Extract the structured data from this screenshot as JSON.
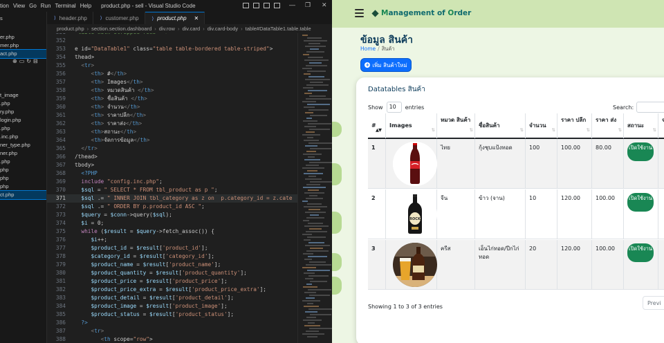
{
  "vscode": {
    "menu": [
      "ction",
      "View",
      "Go",
      "Run",
      "Terminal",
      "Help"
    ],
    "window_title": "product.php - sell - Visual Studio Code",
    "tabs": [
      {
        "label": "header.php",
        "active": false
      },
      {
        "label": "customer.php",
        "active": false
      },
      {
        "label": "product.php",
        "active": true
      }
    ],
    "breadcrumbs": [
      "product.php",
      "section.section.dashboard",
      "div.row",
      "div.card",
      "div.card-body",
      "table#DataTable1.table.table"
    ],
    "explorer_items": [
      {
        "label": "s",
        "active": false
      },
      {
        "label": "er.php",
        "active": false
      },
      {
        "label": "mer.php",
        "active": false
      },
      {
        "label": "act.php",
        "active": true
      },
      {
        "label": "t_image",
        "active": false
      },
      {
        "label": ".php",
        "active": false
      },
      {
        "label": "ry.php",
        "active": false
      },
      {
        "label": "login.php",
        "active": false
      },
      {
        "label": ".php",
        "active": false
      },
      {
        "label": ".inc.php",
        "active": false
      },
      {
        "label": "ner_type.php",
        "active": false
      },
      {
        "label": "ner.php",
        "active": false
      },
      {
        "label": ".php",
        "active": false
      },
      {
        "label": "php",
        "active": false
      },
      {
        "label": "php",
        "active": false
      },
      {
        "label": "php",
        "active": false
      },
      {
        "label": "ct.php",
        "active": true
      }
    ],
    "code_lines": [
      {
        "n": "351",
        "text": " table with stripped rows -->"
      },
      {
        "n": "352",
        "text": ""
      },
      {
        "n": "353",
        "text": "e id=\"DataTable1\" class=\"table table-bordered table-striped\">"
      },
      {
        "n": "354",
        "text": "thead>"
      },
      {
        "n": "355",
        "text": "  <tr>"
      },
      {
        "n": "356",
        "text": "     <th> #</th>"
      },
      {
        "n": "357",
        "text": "     <th> Images</th>"
      },
      {
        "n": "358",
        "text": "     <th> หมวดสินค้า </th>"
      },
      {
        "n": "359",
        "text": "     <th> ชื่อสินค้า </th>"
      },
      {
        "n": "360",
        "text": "     <th> จำนวน</th>"
      },
      {
        "n": "361",
        "text": "     <th> ราคาปลีก</th>"
      },
      {
        "n": "362",
        "text": "     <th> ราคาส่ง</th>"
      },
      {
        "n": "363",
        "text": "     <th>สถานะ</th>"
      },
      {
        "n": "364",
        "text": "     <th>จัดการข้อมูล</th>"
      },
      {
        "n": "365",
        "text": "  </tr>"
      },
      {
        "n": "366",
        "text": "/thead>"
      },
      {
        "n": "367",
        "text": "tbody>"
      },
      {
        "n": "368",
        "text": "  <?PHP"
      },
      {
        "n": "369",
        "text": "  include \"config.inc.php\";"
      },
      {
        "n": "370",
        "text": "  $sql = \" SELECT * FROM tbl_product as p \";"
      },
      {
        "n": "371",
        "text": "  $sql .= \" INNER JOIN tbl_category as z on  p.category_id = z.cate"
      },
      {
        "n": "372",
        "text": "  $sql .= \" ORDER BY p.product_id ASC \";"
      },
      {
        "n": "373",
        "text": "  $query = $conn->query($sql);"
      },
      {
        "n": "374",
        "text": "  $i = 0;"
      },
      {
        "n": "375",
        "text": "  while ($result = $query->fetch_assoc()) {"
      },
      {
        "n": "376",
        "text": "     $i++;"
      },
      {
        "n": "377",
        "text": "     $product_id = $result['product_id'];"
      },
      {
        "n": "378",
        "text": "     $category_id = $result['category_id'];"
      },
      {
        "n": "379",
        "text": "     $product_name = $result['product_name'];"
      },
      {
        "n": "380",
        "text": "     $product_quantity = $result['product_quantity'];"
      },
      {
        "n": "381",
        "text": "     $product_price = $result['product_price'];"
      },
      {
        "n": "382",
        "text": "     $product_price_extra = $result['product_price_extra'];"
      },
      {
        "n": "383",
        "text": "     $product_detail = $result['product_detail'];"
      },
      {
        "n": "384",
        "text": "     $product_image = $result['product_image'];"
      },
      {
        "n": "385",
        "text": "     $product_status = $result['product_status'];"
      },
      {
        "n": "386",
        "text": "  ?>"
      },
      {
        "n": "387",
        "text": "     <tr>"
      },
      {
        "n": "388",
        "text": "        <th scope=\"row\">"
      }
    ],
    "highlighted_line": "371"
  },
  "browser": {
    "brand": {
      "prefix": "M",
      "middle": "anagement of ",
      "accent": "O",
      "suffix": "rder"
    },
    "page_title": "ข้อมูล สินค้า",
    "breadcrumb": {
      "home": "Home",
      "current": "สินค้า"
    },
    "add_button": "เพิ่ม สินค้าใหม่",
    "card_title": "Datatables สินค้า",
    "show_label": "Show",
    "entries_value": "10",
    "entries_label": "entries",
    "search_label": "Search:",
    "columns": [
      {
        "label": "#",
        "sort": "▲▼"
      },
      {
        "label": "Images",
        "sort": "⇅"
      },
      {
        "label": "หมวด สินค้า",
        "sort": "⇅"
      },
      {
        "label": "ชื่อสินค้า",
        "sort": "⇅"
      },
      {
        "label": "จำนวน",
        "sort": "⇅"
      },
      {
        "label": "ราคา ปลีก",
        "sort": "⇅"
      },
      {
        "label": "ราคา ส่ง",
        "sort": "⇅"
      },
      {
        "label": "สถานะ",
        "sort": "⇅"
      },
      {
        "label": "จ",
        "sort": ""
      }
    ],
    "rows": [
      {
        "num": "1",
        "image": "coca-cola-bottle",
        "category": "ไทย",
        "name": "กุ้งชุบแป้งทอด",
        "qty": "100",
        "price": "100.00",
        "price_extra": "80.00",
        "status": "เปิดใช้งาน"
      },
      {
        "num": "2",
        "image": "rock-beer-bottle",
        "category": "จีน",
        "name": "ข้าว (จาน)",
        "qty": "10",
        "price": "120.00",
        "price_extra": "100.00",
        "status": "เปิดใช้งาน"
      },
      {
        "num": "3",
        "image": "beer-glass-bottle",
        "category": "ครีส",
        "name": "เอ็นไก่ทอด/ปีกไก่ทอด",
        "qty": "20",
        "price": "120.00",
        "price_extra": "100.00",
        "status": "เปิดใช้งาน"
      }
    ],
    "info": "Showing 1 to 3 of 3 entries",
    "prev_label": "Previ"
  }
}
